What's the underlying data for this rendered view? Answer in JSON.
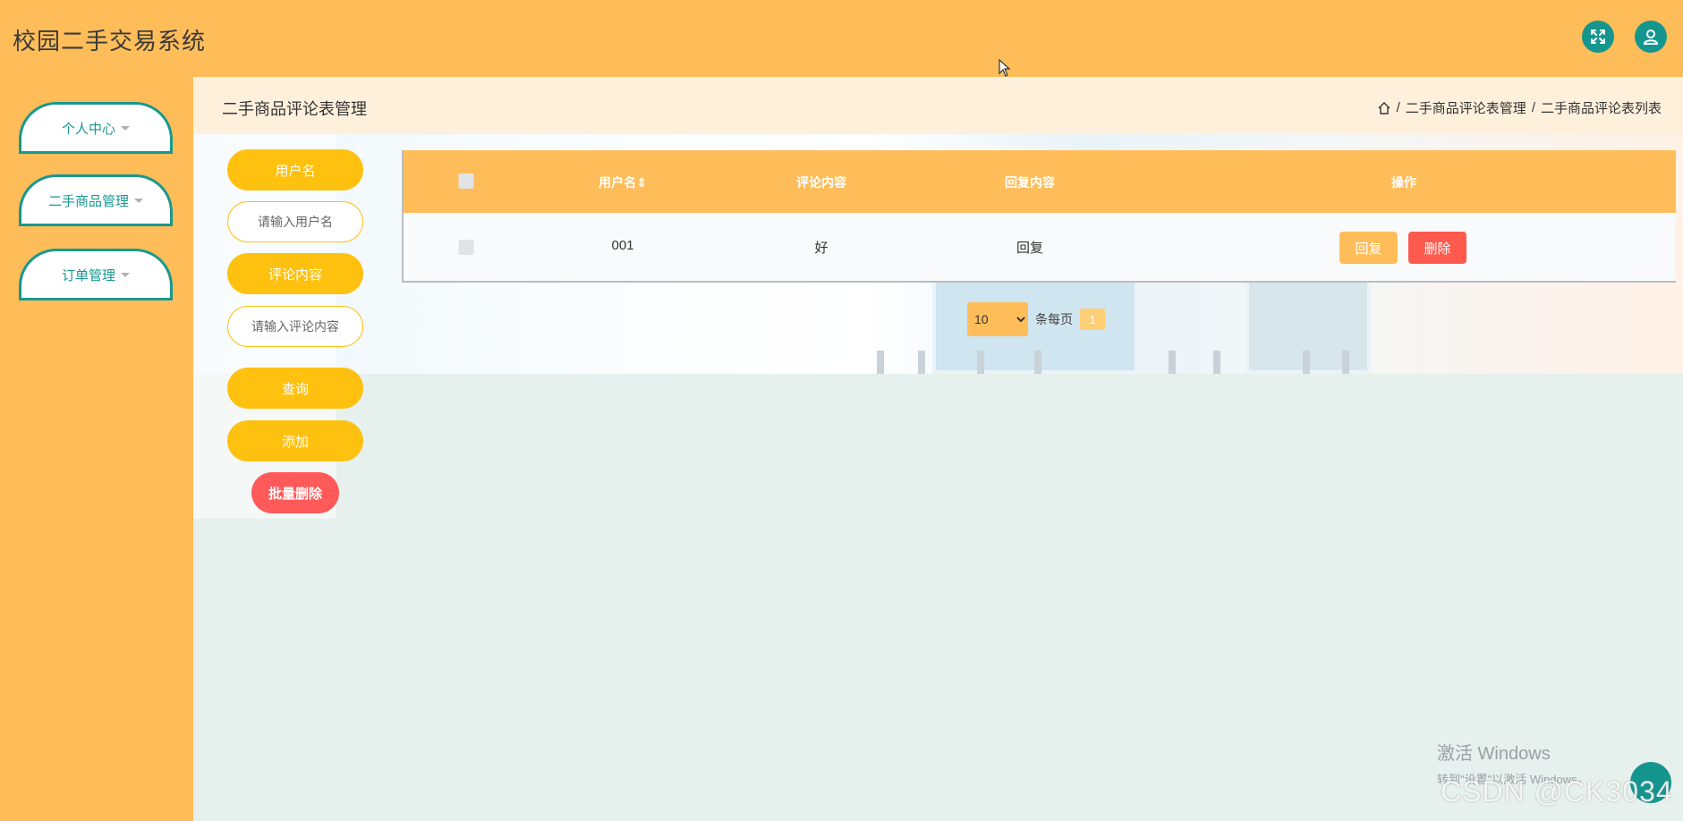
{
  "app": {
    "title": "校园二手交易系统"
  },
  "header": {
    "icons": [
      "fullscreen-icon",
      "user-icon"
    ]
  },
  "sidebar": {
    "items": [
      {
        "label": "个人中心"
      },
      {
        "label": "二手商品管理"
      },
      {
        "label": "订单管理"
      }
    ]
  },
  "page": {
    "title": "二手商品评论表管理",
    "breadcrumb": [
      "二手商品评论表管理",
      "二手商品评论表列表"
    ],
    "separator": "/"
  },
  "search": {
    "username_label": "用户名",
    "username_placeholder": "请输入用户名",
    "comment_label": "评论内容",
    "comment_placeholder": "请输入评论内容",
    "query_button": "查询",
    "add_button": "添加",
    "batch_delete_button": "批量删除"
  },
  "table": {
    "headers": {
      "username": "用户名",
      "sort_icon": "⇕",
      "comment": "评论内容",
      "reply": "回复内容",
      "actions": "操作"
    },
    "rows": [
      {
        "username": "001",
        "comment": "好",
        "reply": "回复",
        "reply_button": "回复",
        "delete_button": "删除"
      }
    ]
  },
  "pagination": {
    "page_size": "10",
    "page_size_options": [
      "10"
    ],
    "per_page_label": "条每页",
    "current_page": "1"
  },
  "watermark": {
    "activate_title": "激活 Windows",
    "activate_hint": "转到\"设置\"以激活 Windows。",
    "csdn": "CSDN @CK3034"
  },
  "colors": {
    "header_bg": "#ffbd5a",
    "accent_teal": "#14968f",
    "button_yellow": "#ffc10f",
    "danger_red": "#ff5a4e"
  }
}
